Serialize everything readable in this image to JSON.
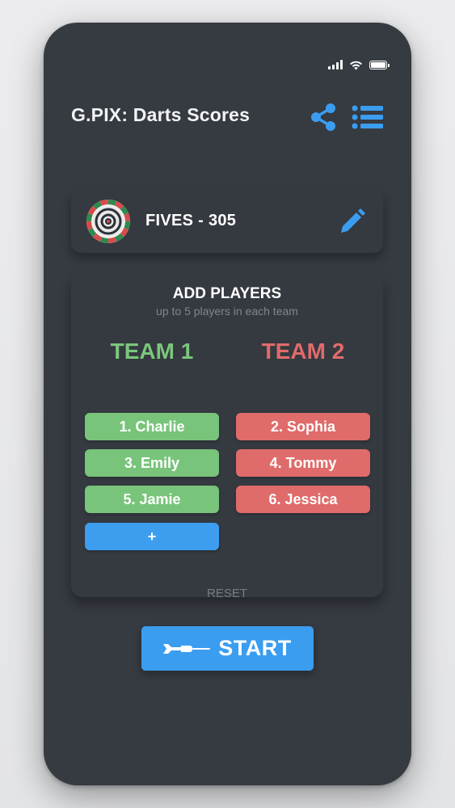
{
  "app": {
    "title": "G.PIX: Darts Scores"
  },
  "game": {
    "name": "FIVES - 305"
  },
  "players_section": {
    "title": "ADD PLAYERS",
    "subtitle": "up to 5 players in each team",
    "reset_label": "RESET"
  },
  "teams": [
    {
      "name": "TEAM 1",
      "color": "#7ac77c",
      "players": [
        "1. Charlie",
        "3. Emily",
        "5. Jamie"
      ],
      "add_label": "+"
    },
    {
      "name": "TEAM 2",
      "color": "#e06b6b",
      "players": [
        "2. Sophia",
        "4. Tommy",
        "6. Jessica"
      ]
    }
  ],
  "start_label": "START",
  "colors": {
    "background": "#363a41",
    "accent": "#3b9df0",
    "team1": "#79c47b",
    "team2": "#e06b6b"
  },
  "icons": {
    "share": "share-icon",
    "menu": "list-icon",
    "edit": "pencil-icon",
    "dartboard": "dartboard-icon",
    "dart": "dart-icon"
  }
}
